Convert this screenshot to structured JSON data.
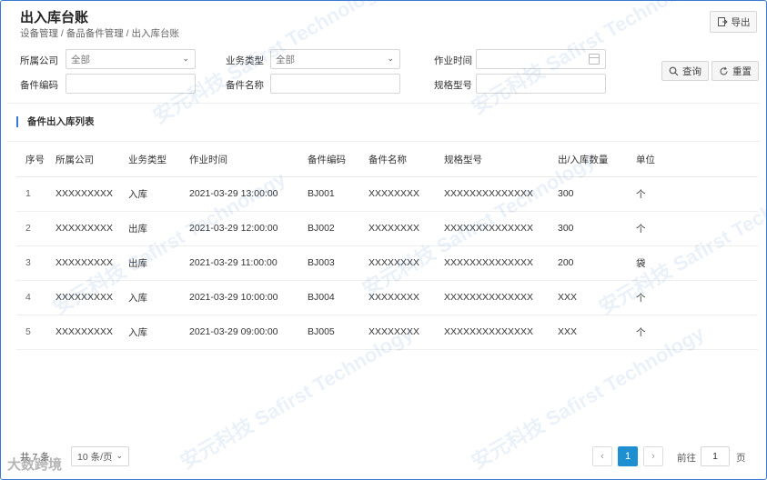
{
  "page": {
    "title": "出入库台账",
    "breadcrumb": [
      "设备管理 /",
      "备品备件管理 /",
      "出入库台账"
    ],
    "export_label": "导出"
  },
  "filters": {
    "company_label": "所属公司",
    "company_value": "全部",
    "biz_type_label": "业务类型",
    "biz_type_value": "全部",
    "op_time_label": "作业时间",
    "part_code_label": "备件编码",
    "part_name_label": "备件名称",
    "spec_label": "规格型号",
    "query_label": "查询",
    "reset_label": "重置"
  },
  "section": {
    "title": "备件出入库列表"
  },
  "table": {
    "headers": [
      "序号",
      "所属公司",
      "业务类型",
      "作业时间",
      "备件编码",
      "备件名称",
      "规格型号",
      "出/入库数量",
      "单位"
    ],
    "rows": [
      [
        "1",
        "XXXXXXXXX",
        "入库",
        "2021-03-29 13:00:00",
        "BJ001",
        "XXXXXXXX",
        "XXXXXXXXXXXXXX",
        "300",
        "个"
      ],
      [
        "2",
        "XXXXXXXXX",
        "出库",
        "2021-03-29 12:00:00",
        "BJ002",
        "XXXXXXXX",
        "XXXXXXXXXXXXXX",
        "300",
        "个"
      ],
      [
        "3",
        "XXXXXXXXX",
        "出库",
        "2021-03-29 11:00:00",
        "BJ003",
        "XXXXXXXX",
        "XXXXXXXXXXXXXX",
        "200",
        "袋"
      ],
      [
        "4",
        "XXXXXXXXX",
        "入库",
        "2021-03-29 10:00:00",
        "BJ004",
        "XXXXXXXX",
        "XXXXXXXXXXXXXX",
        "XXX",
        "个"
      ],
      [
        "5",
        "XXXXXXXXX",
        "入库",
        "2021-03-29 09:00:00",
        "BJ005",
        "XXXXXXXX",
        "XXXXXXXXXXXXXX",
        "XXX",
        "个"
      ]
    ]
  },
  "pagination": {
    "total_text": "共 7 条",
    "page_size": "10 条/页",
    "current_page": "1",
    "goto_label": "前往",
    "goto_value": "1",
    "page_unit": "页"
  },
  "watermark": {
    "text": "安元科技 Safirst Technology",
    "bottom_text": "大数跨境"
  },
  "colors": {
    "accent": "#1e8fd1",
    "border": "#3a78d6"
  },
  "icons": [
    "export-icon",
    "search-icon",
    "refresh-icon",
    "calendar-icon",
    "chevron-down-icon",
    "chevron-left-icon",
    "chevron-right-icon"
  ]
}
